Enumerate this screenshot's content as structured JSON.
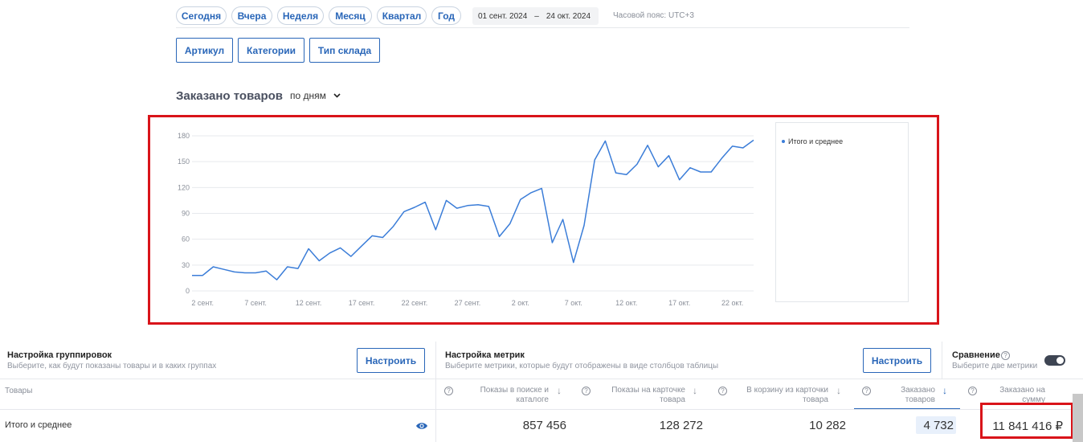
{
  "period_buttons": [
    "Сегодня",
    "Вчера",
    "Неделя",
    "Месяц",
    "Квартал",
    "Год"
  ],
  "date_range": {
    "start": "01 сент. 2024",
    "dash": "–",
    "end": "24 окт. 2024"
  },
  "timezone": "Часовой пояс: UTC+3",
  "filters": [
    "Артикул",
    "Категории",
    "Тип склада"
  ],
  "chart_section": {
    "title": "Заказано товаров",
    "granularity": "по дням"
  },
  "chart_data": {
    "type": "line",
    "ylim": [
      0,
      180
    ],
    "yticks": [
      "0",
      "30",
      "60",
      "90",
      "120",
      "150",
      "180"
    ],
    "xtick_labels": [
      "2 сент.",
      "7 сент.",
      "12 сент.",
      "17 сент.",
      "22 сент.",
      "27 сент.",
      "2 окт.",
      "7 окт.",
      "12 окт.",
      "17 окт.",
      "22 окт."
    ],
    "xtick_index": [
      1,
      6,
      11,
      16,
      21,
      26,
      31,
      36,
      41,
      46,
      51
    ],
    "grid": true,
    "legend": "right",
    "series": [
      {
        "name": "Итого и среднее",
        "color": "#3b7dd8",
        "values": [
          18,
          18,
          28,
          25,
          22,
          21,
          21,
          23,
          13,
          28,
          26,
          49,
          35,
          44,
          50,
          40,
          52,
          64,
          62,
          75,
          92,
          97,
          103,
          71,
          105,
          96,
          99,
          100,
          98,
          63,
          78,
          106,
          114,
          119,
          56,
          83,
          33,
          76,
          152,
          174,
          137,
          135,
          147,
          169,
          144,
          157,
          129,
          143,
          138,
          138,
          154,
          168,
          166,
          175
        ]
      }
    ]
  },
  "groupings_panel": {
    "title": "Настройка группировок",
    "subtitle": "Выберите, как будут показаны товары и в каких группах",
    "button": "Настроить"
  },
  "metrics_panel": {
    "title": "Настройка метрик",
    "subtitle": "Выберите метрики, которые будут отображены в виде столбцов таблицы",
    "button": "Настроить"
  },
  "comparison_panel": {
    "title": "Сравнение",
    "subtitle": "Выберите две метрики",
    "help": "?"
  },
  "table": {
    "first_col_header": "Товары",
    "columns": [
      {
        "line1": "Показы в поиске и",
        "line2": "каталоге",
        "help": "?",
        "arrow": "↓"
      },
      {
        "line1": "Показы на карточке",
        "line2": "товара",
        "help": "?",
        "arrow": "↓"
      },
      {
        "line1": "В корзину из карточки",
        "line2": "товара",
        "help": "?",
        "arrow": "↓"
      },
      {
        "line1": "Заказано",
        "line2": "товаров",
        "help": "?",
        "arrow": "↓"
      },
      {
        "line1": "Заказано на",
        "line2": "сумму",
        "help": "?",
        "arrow": ""
      }
    ],
    "row": {
      "label": "Итого и среднее",
      "values": [
        "857 456",
        "128 272",
        "10 282",
        "4 732",
        "11 841 416 ₽"
      ]
    }
  },
  "colors": {
    "accent": "#2966b8",
    "line": "#3b7dd8",
    "highlight_box": "#d9141a",
    "selected_cell_bg": "#e8f0fb"
  }
}
